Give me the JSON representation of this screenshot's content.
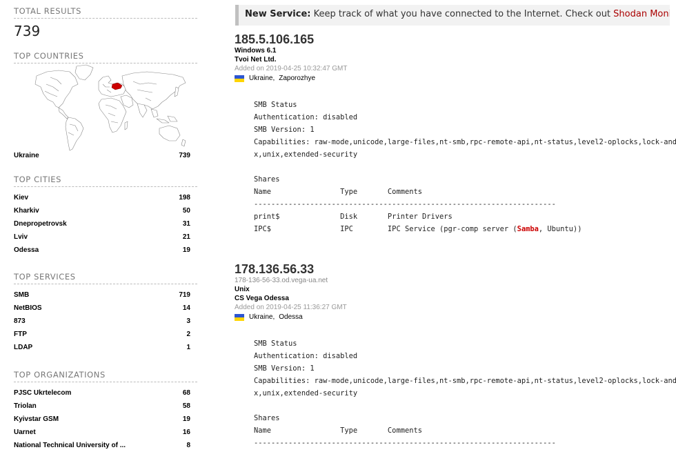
{
  "summary": {
    "total_results_title": "TOTAL RESULTS",
    "total_results": "739",
    "top_countries_title": "TOP COUNTRIES",
    "countries": [
      {
        "name": "Ukraine",
        "count": "739"
      }
    ],
    "top_cities_title": "TOP CITIES",
    "cities": [
      {
        "name": "Kiev",
        "count": "198"
      },
      {
        "name": "Kharkiv",
        "count": "50"
      },
      {
        "name": "Dnepropetrovsk",
        "count": "31"
      },
      {
        "name": "Lviv",
        "count": "21"
      },
      {
        "name": "Odessa",
        "count": "19"
      }
    ],
    "top_services_title": "TOP SERVICES",
    "services": [
      {
        "name": "SMB",
        "count": "719"
      },
      {
        "name": "NetBIOS",
        "count": "14"
      },
      {
        "name": "873",
        "count": "3"
      },
      {
        "name": "FTP",
        "count": "2"
      },
      {
        "name": "LDAP",
        "count": "1"
      }
    ],
    "top_orgs_title": "TOP ORGANIZATIONS",
    "orgs": [
      {
        "name": "PJSC Ukrtelecom",
        "count": "68"
      },
      {
        "name": "Triolan",
        "count": "58"
      },
      {
        "name": "Kyivstar GSM",
        "count": "19"
      },
      {
        "name": "Uarnet",
        "count": "16"
      },
      {
        "name": "National Technical University of ...",
        "count": "8"
      }
    ]
  },
  "banner": {
    "label": "New Service:",
    "text": "Keep track of what you have connected to the Internet. Check out",
    "link": "Shodan Monitor"
  },
  "results": [
    {
      "ip": "185.5.106.165",
      "os": "Windows 6.1",
      "org": "Tvoi Net Ltd.",
      "added": "Added on 2019-04-25 10:32:47 GMT",
      "country": "Ukraine",
      "city": "Zaporozhye",
      "data": {
        "pre": "SMB Status\nAuthentication: disabled\nSMB Version: 1\nCapabilities: raw-mode,unicode,large-files,nt-smb,rpc-remote-api,nt-status,level2-oplocks,lock-and-read,nt-find,dfs,infolevel-passthru,large-readx,large-writex,unix,extended-security\n\nShares\nName                Type       Comments\n----------------------------------------------------------------------\nprint$              Disk       Printer Drivers\nIPC$                IPC        IPC Service (pgr-comp server (",
        "highlight": "Samba",
        "post": ", Ubuntu))"
      }
    },
    {
      "ip": "178.136.56.33",
      "hostname": "178-136-56-33.od.vega-ua.net",
      "os": "Unix",
      "org": "CS Vega Odessa",
      "added": "Added on 2019-04-25 11:36:27 GMT",
      "country": "Ukraine",
      "city": "Odessa",
      "data": {
        "pre": "SMB Status\nAuthentication: disabled\nSMB Version: 1\nCapabilities: raw-mode,unicode,large-files,nt-smb,rpc-remote-api,nt-status,level2-oplocks,lock-and-read,nt-find,dfs,infolevel-passthru,large-readx,large-writex,unix,extended-security\n\nShares\nName                Type       Comments\n----------------------------------------------------------------------"
      }
    }
  ],
  "colors": {
    "link": "#aa0000",
    "highlight_country": "#cc0000",
    "flag_blue": "#2d56d1",
    "flag_yellow": "#ffd500"
  }
}
